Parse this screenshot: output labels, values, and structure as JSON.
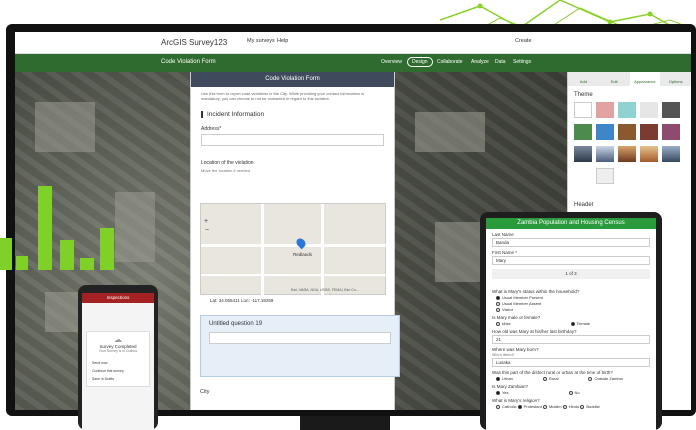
{
  "header": {
    "app_name": "ArcGIS Survey123",
    "menu": [
      "My surveys",
      "Help"
    ],
    "create_label": "Create"
  },
  "navbar": {
    "form_title": "Code Violation Form",
    "tabs": [
      "Overview",
      "Design",
      "Collaborate",
      "Analyze",
      "Data",
      "Settings"
    ],
    "active_tab": "Design"
  },
  "form": {
    "title": "Code Violation Form",
    "intro": "Use this form to report code violations in the City. While providing your contact information is mandatory, you can choose to not be contacted in regard to this incident.",
    "section": "Incident Information",
    "address_label": "Address*",
    "location_label": "Location of the violation",
    "location_hint": "Move the location if needed.",
    "map_city": "Redlands",
    "map_credit": "Esri, NASA, NGA, USGS, FEMA | Esri Co...",
    "latlon": "Lat: 34.055411   Lon: -117.18259",
    "question19": "Untitled question 19",
    "city_label": "City"
  },
  "panel": {
    "tabs": [
      "Add",
      "Edit",
      "Appearance",
      "Options"
    ],
    "active_tab": "Appearance",
    "theme_label": "Theme",
    "header_label": "Header",
    "swatches": [
      "#e0a3a1",
      "#8fd2d1",
      "#e6e6e6",
      "#555555",
      "#4d8a4e",
      "#3f86c8",
      "#8a5a2e",
      "#7b3b33",
      "#8e4a6f"
    ]
  },
  "phone": {
    "header": "Inspections",
    "dialog_title": "Survey Completed",
    "dialog_sub": "Your Survey is in Outbox",
    "items": [
      "Send now",
      "Continue this survey",
      "Save in Drafts"
    ]
  },
  "tablet": {
    "title": "Zambia Population and Housing Census",
    "last_name_label": "Last Name",
    "last_name": "Banda",
    "first_name_label": "First Name *",
    "first_name": "Mary",
    "pager": "1 of 3",
    "status_q": "What is Mary's status within the household?",
    "status_opts": [
      "Usual Member Present",
      "Usual Member Absent",
      "Visitor"
    ],
    "sex_q": "Is Mary male or female?",
    "sex_opts": [
      "Male",
      "Female"
    ],
    "age_q": "How old was Mary at his/her last birthday?",
    "age": "21",
    "born_q": "Where was Mary born?",
    "born_sub": "Which district?",
    "born": "Lusaka",
    "area_q": "Was this part of the district rural or urban at the time of birth?",
    "area_opts": [
      "Urban",
      "Rural",
      "Outside Zambia"
    ],
    "zambian_q": "Is Mary Zambian?",
    "zambian_opts": [
      "Yes",
      "No"
    ],
    "religion_q": "What is Mary's religion?",
    "religion_opts": [
      "Catholic",
      "Protestant",
      "Muslim",
      "Hindu",
      "Buddist"
    ]
  }
}
